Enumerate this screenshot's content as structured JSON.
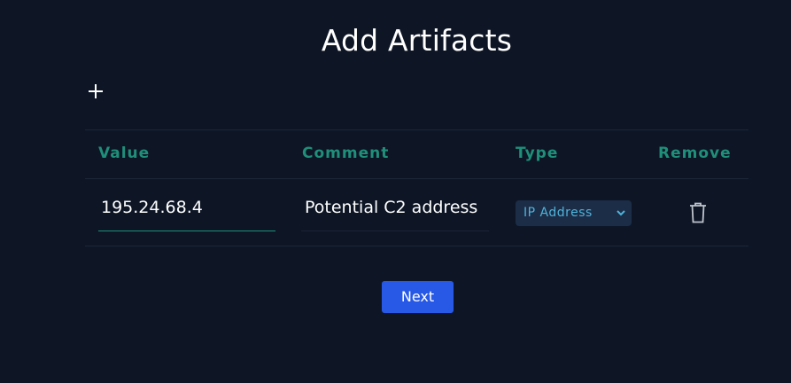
{
  "page": {
    "title": "Add Artifacts"
  },
  "add_button": {
    "icon": "plus-icon"
  },
  "table": {
    "headers": {
      "value": "Value",
      "comment": "Comment",
      "type": "Type",
      "remove": "Remove"
    },
    "rows": [
      {
        "value": "195.24.68.4",
        "comment": "Potential C2 address",
        "type": "IP Address",
        "remove_icon": "trash-icon"
      }
    ]
  },
  "next_button": {
    "label": "Next"
  },
  "colors": {
    "background": "#0e1626",
    "header_accent": "#1f8f7a",
    "select_bg": "#1c2d48",
    "select_text": "#4fb3d9",
    "primary_button": "#2759e6"
  }
}
